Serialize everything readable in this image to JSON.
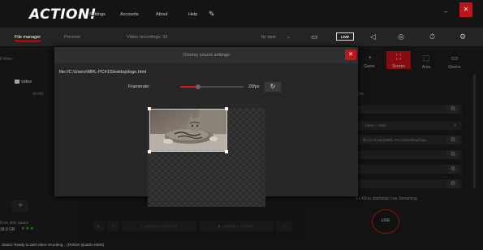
{
  "app": {
    "logo": "ACTION!"
  },
  "topmenu": {
    "settings": "Settings",
    "accounts": "Accounts",
    "about": "About",
    "help": "Help"
  },
  "tabs": {
    "file_manager": "File manager",
    "preview": "Preview",
    "recordings": "Video recordings: 33",
    "sort": "by date"
  },
  "right_tabs": {
    "live": "LIVE"
  },
  "leftpanel": {
    "folder": "Folder:",
    "video": "video",
    "desktop": "deskt",
    "free_disk_label": "Free disk space",
    "free_disk_value": "18.9 GB",
    "stars": "★★★"
  },
  "sharebar": {
    "facebook": "Upload to Facebook",
    "youtube": "Upload to YouTube"
  },
  "status": {
    "text": "Status:  Ready to start video recording... (NVIDIA Quadro K600)"
  },
  "modes": [
    {
      "label": "Game",
      "icon": "gamepad-icon"
    },
    {
      "label": "Screen",
      "icon": "screen-select-icon"
    },
    {
      "label": "Area",
      "icon": "area-icon"
    },
    {
      "label": "Device",
      "icon": "device-icon"
    }
  ],
  "rightpanel": {
    "sources_label": "ces",
    "hud_option": "Video + HUD",
    "path_value": "file://C:/Users/MRL-PC41/Desktop/logo...",
    "hotkey_hint": "l + F9 to start/stop Live Streaming",
    "live_button": "LIVE"
  },
  "modal": {
    "title": "Overlay source settings",
    "close": "✕",
    "source_path": "file://C:\\Users\\MRL-PC41\\Desktop\\logo.html",
    "framerate_label": "Framerate:",
    "framerate_value": "20fps",
    "framerate_fraction": 0.28
  },
  "colors": {
    "accent": "#d0121a",
    "background": "#1c1c1c"
  }
}
